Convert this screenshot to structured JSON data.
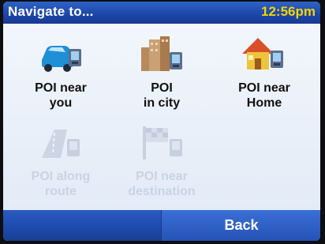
{
  "header": {
    "title": "Navigate to...",
    "time": "12:56pm"
  },
  "menu": {
    "items": [
      {
        "label_line1": "POI near",
        "label_line2": "you",
        "icon": "car-poi-icon",
        "enabled": true
      },
      {
        "label_line1": "POI",
        "label_line2": "in city",
        "icon": "city-buildings-poi-icon",
        "enabled": true
      },
      {
        "label_line1": "POI near",
        "label_line2": "Home",
        "icon": "home-poi-icon",
        "enabled": true
      },
      {
        "label_line1": "POI along",
        "label_line2": "route",
        "icon": "route-poi-icon",
        "enabled": false
      },
      {
        "label_line1": "POI near",
        "label_line2": "destination",
        "icon": "destination-flag-poi-icon",
        "enabled": false
      }
    ]
  },
  "footer": {
    "back_label": "Back"
  },
  "colors": {
    "title_bar": "#1d45a8",
    "clock_text": "#f3d400",
    "screen_bg": "#e6eef9",
    "disabled_text": "#c9d3e2"
  }
}
